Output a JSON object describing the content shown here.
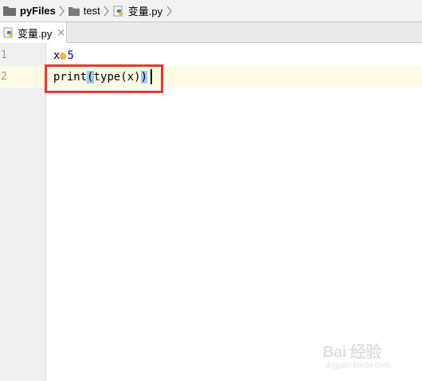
{
  "breadcrumb": {
    "project": "pyFiles",
    "folder": "test",
    "file": "变量.py"
  },
  "tabs": [
    {
      "label": "变量.py",
      "close": "×"
    }
  ],
  "editor": {
    "line_numbers": [
      "1",
      "2"
    ],
    "lines": {
      "l1_var": "x",
      "l1_val": "5",
      "l2_func": "print",
      "l2_open": "(",
      "l2_mid": "type(x)",
      "l2_close": ")"
    }
  },
  "watermark": {
    "brand": "Bai 经验",
    "sub": "jingyan.baidu.com"
  },
  "colors": {
    "current_line": "#fffae3",
    "number_literal": "#0000ff",
    "highlight_box": "#e53935",
    "paren_match": "#99ccff"
  }
}
